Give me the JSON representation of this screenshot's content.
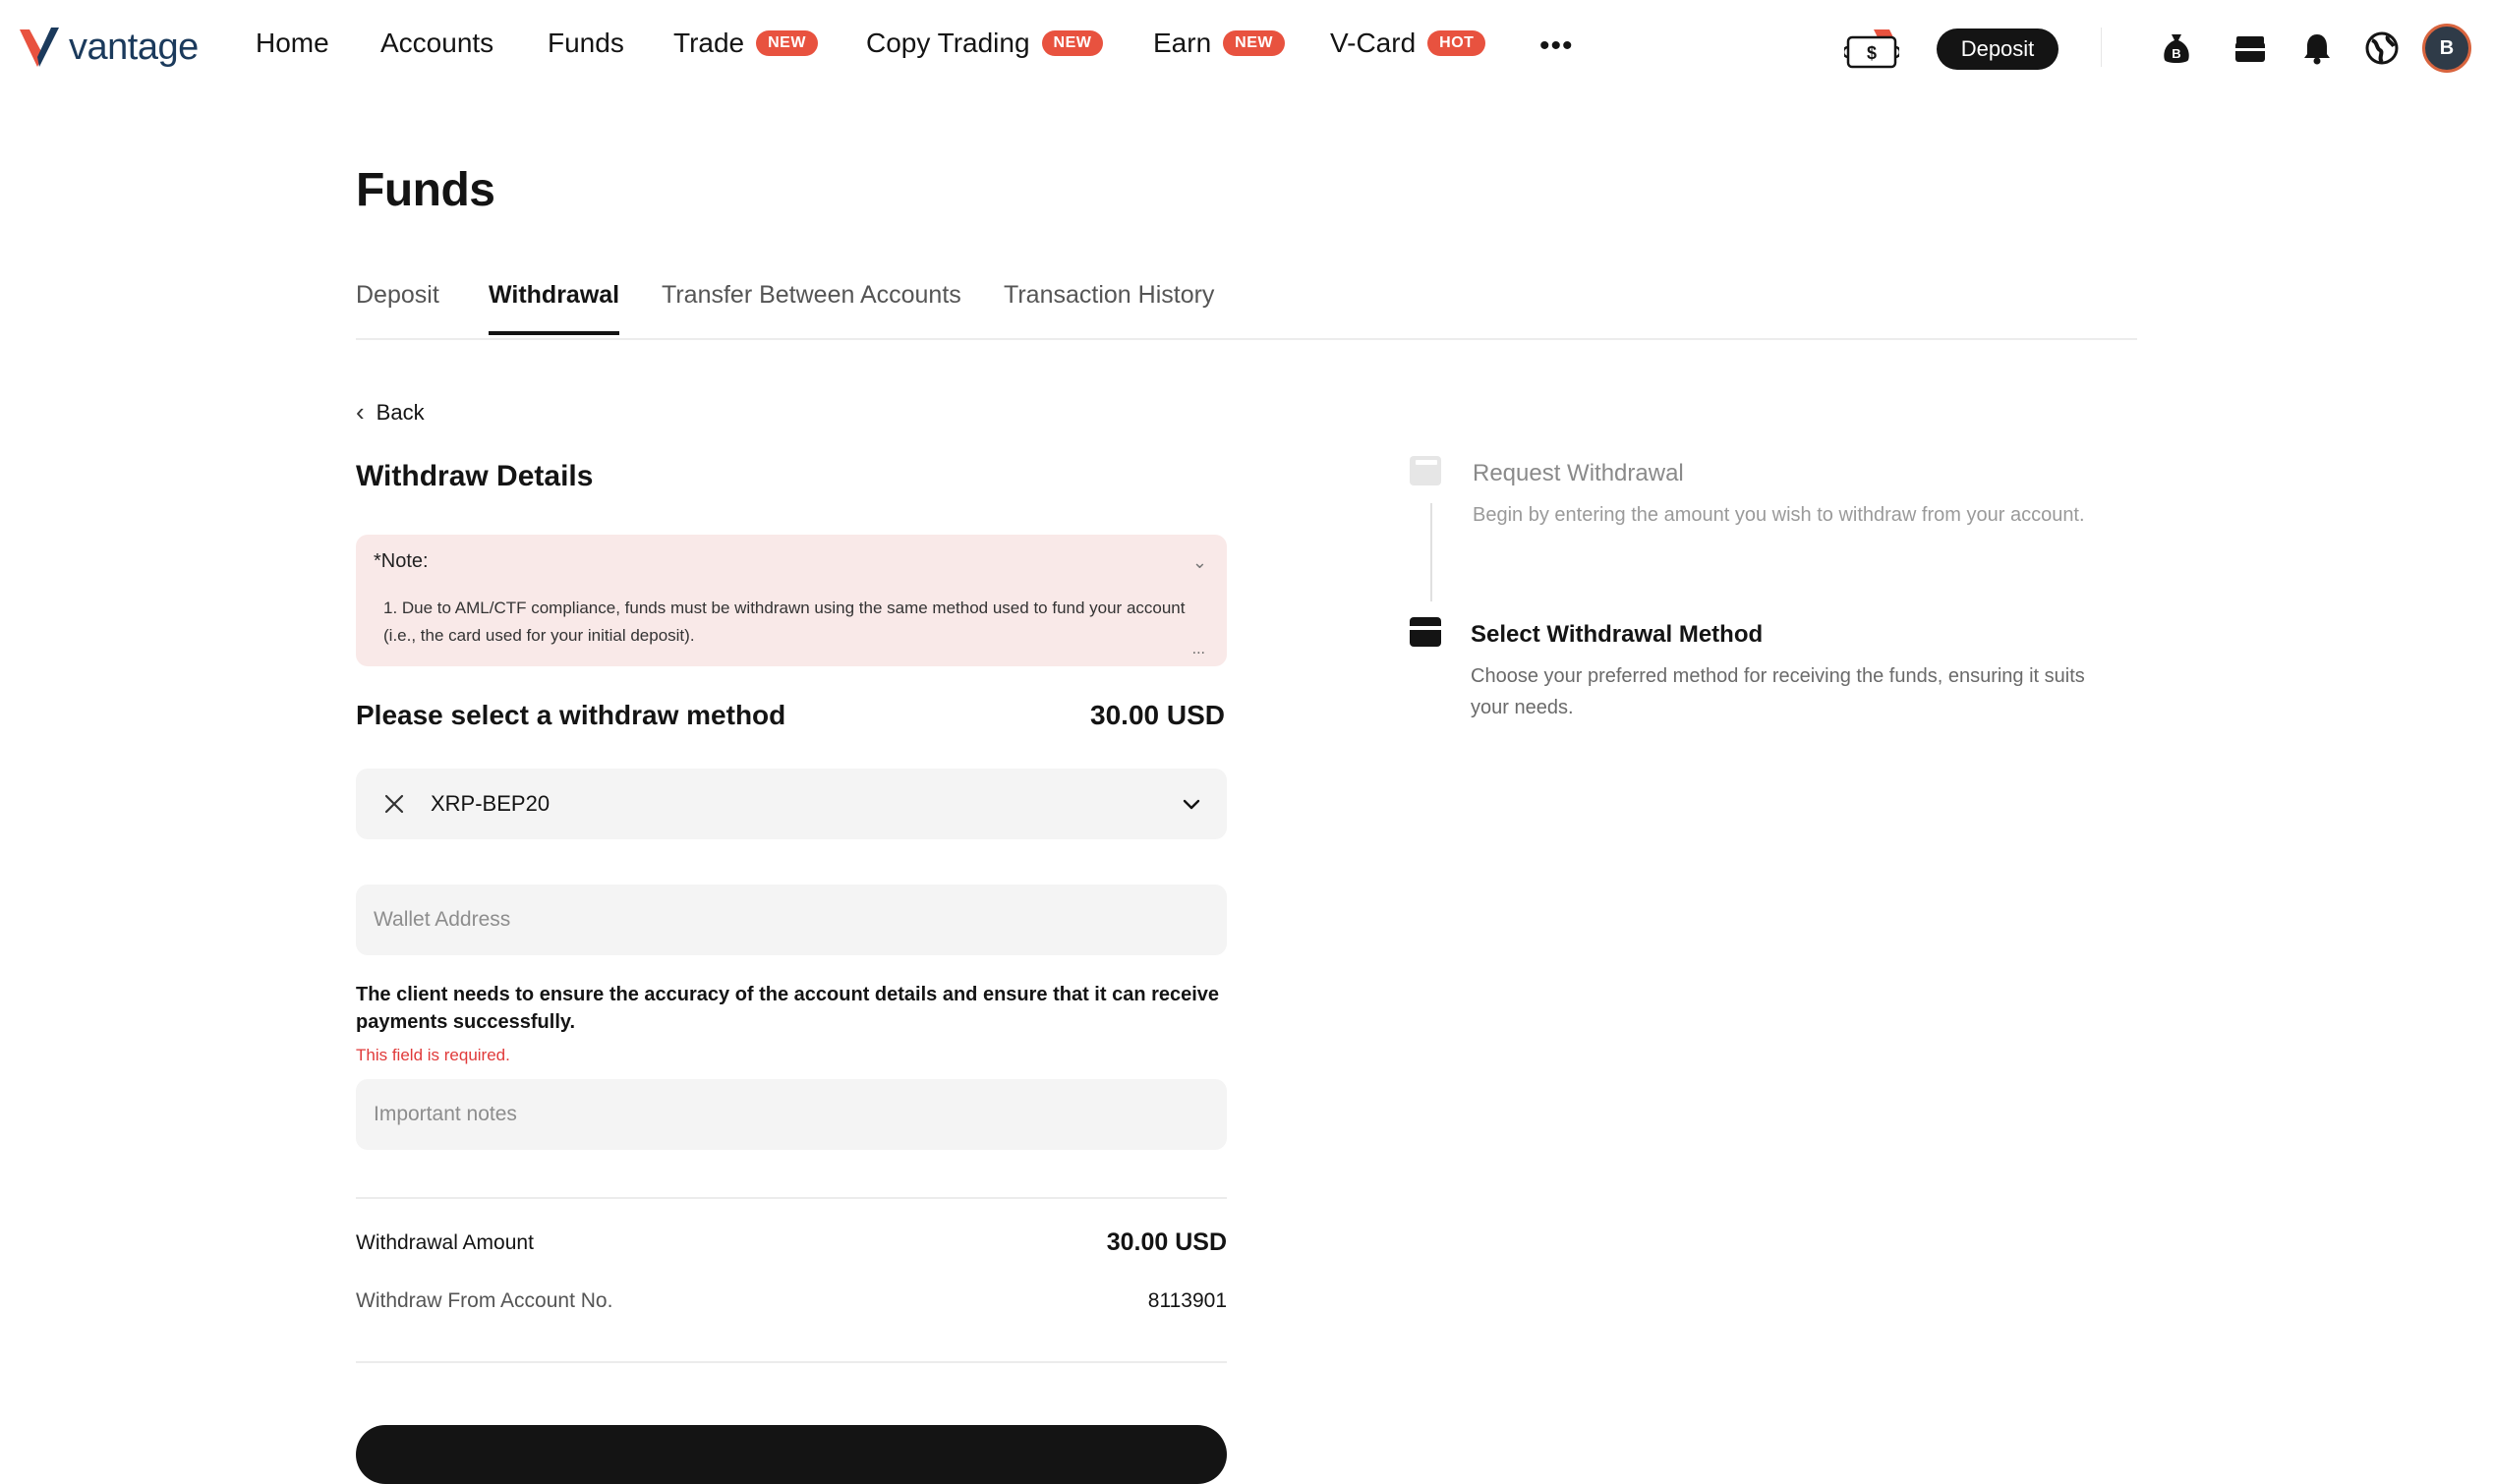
{
  "nav": {
    "logo_text": "vantage",
    "items": [
      {
        "label": "Home",
        "badge": ""
      },
      {
        "label": "Accounts",
        "badge": ""
      },
      {
        "label": "Funds",
        "badge": ""
      },
      {
        "label": "Trade",
        "badge": "NEW"
      },
      {
        "label": "Copy Trading",
        "badge": "NEW"
      },
      {
        "label": "Earn",
        "badge": "NEW"
      },
      {
        "label": "V-Card",
        "badge": "HOT"
      }
    ],
    "more_label": "•••",
    "deposit_label": "Deposit",
    "icons": [
      "cash-icon",
      "money-bag-icon",
      "wallet-icon",
      "bell-icon",
      "globe-icon",
      "avatar"
    ],
    "avatar_initial": "B"
  },
  "page": {
    "title": "Funds",
    "tabs": [
      {
        "label": "Deposit",
        "active": false
      },
      {
        "label": "Withdrawal",
        "active": true
      },
      {
        "label": "Transfer Between Accounts",
        "active": false
      },
      {
        "label": "Transaction History",
        "active": false
      }
    ]
  },
  "withdraw": {
    "back_label": "Back",
    "title": "Withdraw Details",
    "note_title": "*Note:",
    "note_text": "1. Due to AML/CTF compliance, funds must be withdrawn using the same method used to fund your account (i.e., the card used for your initial deposit).",
    "note_more": "...",
    "method_prompt": "Please select a withdraw method",
    "method_amount": "30.00 USD",
    "selected_method": "XRP-BEP20",
    "wallet_placeholder": "Wallet Address",
    "wallet_value": "",
    "accuracy_warning": "The client needs to ensure the accuracy of the account details and ensure that it can receive payments successfully.",
    "field_error": "This field is required.",
    "notes_placeholder": "Important notes",
    "notes_value": "",
    "summary": {
      "amount_label": "Withdrawal Amount",
      "amount_value": "30.00 USD",
      "account_label": "Withdraw From Account No.",
      "account_value": "8113901"
    }
  },
  "steps": [
    {
      "title": "Request Withdrawal",
      "description": "Begin by entering the amount you wish to withdraw from your account.",
      "state": "done"
    },
    {
      "title": "Select Withdrawal Method",
      "description": "Choose your preferred method for receiving the funds, ensuring it suits your needs.",
      "state": "current"
    }
  ],
  "colors": {
    "brand_orange": "#e8523f",
    "brand_navy": "#1b3a5c",
    "primary_dark": "#141414",
    "note_bg": "#f9e9e8",
    "error_red": "#e03a3a",
    "input_bg": "#f4f4f4"
  }
}
